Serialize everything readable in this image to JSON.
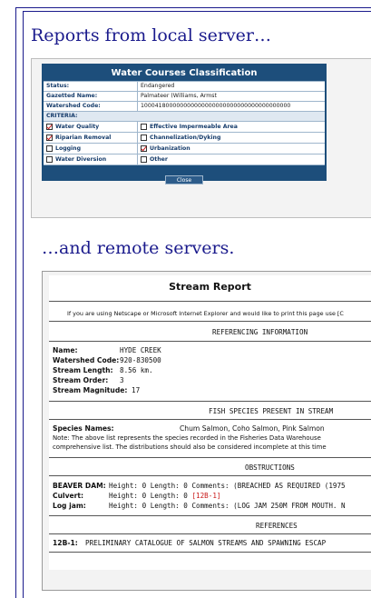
{
  "slide": {
    "heading_local": "Reports from local server…",
    "heading_remote": "…and remote servers."
  },
  "local": {
    "title": "Water Courses Classification",
    "rows": [
      {
        "label": "Status:",
        "value": "Endangered"
      },
      {
        "label": "Gazetted Name:",
        "value": "Palmateer (Williams, Armst"
      },
      {
        "label": "Watershed Code:",
        "value": "100041800000000000000000000000000000000000"
      }
    ],
    "criteria_label": "CRITERIA:",
    "criteria": [
      {
        "left": "Water Quality",
        "left_checked": true,
        "right": "Effective Impermeable Area",
        "right_checked": false
      },
      {
        "left": "Riparian Removal",
        "left_checked": true,
        "right": "Channelization/Dyking",
        "right_checked": false
      },
      {
        "left": "Logging",
        "left_checked": false,
        "right": "Urbanization",
        "right_checked": true
      },
      {
        "left": "Water Diversion",
        "left_checked": false,
        "right": "Other",
        "right_checked": false
      }
    ],
    "close_label": "Close"
  },
  "remote": {
    "title": "Stream Report",
    "print_note": "If you are using Netscape or Microsoft Internet Explorer and would like to print this page use [C",
    "ref_info_heading": "REFERENCING INFORMATION",
    "fields": [
      {
        "label": "Name:",
        "value": "HYDE CREEK"
      },
      {
        "label": "Watershed Code:",
        "value": "920-830500"
      },
      {
        "label": "Stream Length:",
        "value": "8.56 km."
      },
      {
        "label": "Stream Order:",
        "value": "3"
      },
      {
        "label": "Stream Magnitude:",
        "value": "17"
      }
    ],
    "fish_heading": "FISH SPECIES PRESENT IN STREAM",
    "species_label": "Species Names:",
    "species_value": "Chum Salmon, Coho Salmon, Pink Salmon",
    "species_note_1": "Note: The above list represents the species recorded in the Fisheries Data Warehouse",
    "species_note_2": "comprehensive list. The distributions should also be considered incomplete at this time",
    "obstructions_heading": "OBSTRUCTIONS",
    "obstructions": [
      {
        "label": "BEAVER DAM:",
        "height": "Height: 0",
        "length": "Length: 0",
        "ref": "",
        "comments": "Comments: (BREACHED AS REQUIRED (1975"
      },
      {
        "label": "Culvert:",
        "height": "Height: 0",
        "length": "Length: 0",
        "ref": "[12B-1]",
        "comments": ""
      },
      {
        "label": "Log jam:",
        "height": "Height: 0",
        "length": "Length: 0",
        "ref": "",
        "comments": "Comments: (LOG JAM 250M FROM MOUTH. N"
      }
    ],
    "references_heading": "REFERENCES",
    "reference": {
      "code": "12B-1:",
      "text": "PRELIMINARY CATALOGUE OF SALMON STREAMS AND SPAWNING ESCAP"
    }
  }
}
